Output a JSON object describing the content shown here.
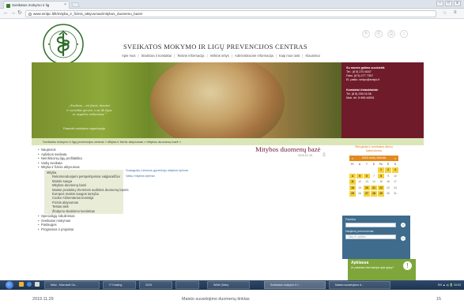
{
  "browser": {
    "tab_title": "Sveikatos mokymo ir lig",
    "url": "www.smlpc.lt/lt/mityba_ir_fizinis_aktyvumas/mitybos_duomenu_baze/",
    "win_min": "–",
    "win_max": "□",
    "win_close": "x"
  },
  "header": {
    "site_title": "SVEIKATOS MOKYMO IR LIGŲ PREVENCIJOS CENTRAS",
    "top_nav": [
      "Apie mus",
      "Struktūra ir kontaktai",
      "Teisinė informacija",
      "Veiklos sritys",
      "Administracinė informacija",
      "Kaip mus rasti",
      "Klausimai"
    ],
    "top_icons": [
      "Ⓐ",
      "⎘",
      "⎙",
      "⌂"
    ]
  },
  "banner": {
    "quote_lines": [
      "„Sveikata – tai fizinė, dvasinė",
      "ir socialinė gerovė, o ne tik ligos",
      "ar negalios nebuvimas.\""
    ],
    "quote_author": "Pasaulio sveikatos organizacija"
  },
  "contact": {
    "heading": "Su mumis galima susisiekti:",
    "lines": [
      "Tel.: (8 5) 270 8167",
      "Faks. (8 5) 277 7307",
      "El. paštu: smlpc@smlpc.lt"
    ],
    "heading2": "Kontaktai žiniasklaidai:",
    "lines2": [
      "Tel. (8 5) 236 04 56",
      "Mob. tel. 8 698 46591"
    ]
  },
  "breadcrumb": [
    "Sveikatos mokymo ir ligų prevencijos centras",
    "Mityba ir fizinis aktyvumas",
    "Mitybos duomenų bazė"
  ],
  "sidebar": {
    "items_top": [
      "Naujienos",
      "Aplinkos sveikata",
      "Neinfekcinių ligų profilaktika",
      "Vaikų sveikata",
      "Mityba ir fizinis aktyvumas"
    ],
    "sub_items": [
      "Mityba",
      "Rekomenduojami perspektyviniai valgiaraščiai",
      "Maisto sauga",
      "Mitybos duomenų bazė",
      "Maisto produktų cheminės sudėties duomenų bazės",
      "Europos maisto saugos tarnyba",
      "Codex Alimentarius komisija",
      "Fizinis aktyvumas",
      "Testas akis",
      "Žindymo skatinimo komitetas"
    ],
    "items_bottom": [
      "Specialiųjų tobulinimas",
      "Sveikatos mokymas",
      "Paslaugos",
      "Programos ir projektai"
    ]
  },
  "main": {
    "title": "Mitybos duomenų bazė",
    "date": "2015.01.15",
    "links": [
      "Suaugusių Lietuvos gyventojų mitybos tyrimai",
      "Vaikų mitybos tyrimai"
    ]
  },
  "calendar": {
    "title": "Renginiai ir sveikatos dienų kalendorius",
    "month": "2015 metų birželis",
    "weekdays": [
      "Pr",
      "A",
      "T",
      "K",
      "Pn",
      "Š",
      "S"
    ],
    "days": [
      "",
      "",
      "",
      "",
      "1",
      "2",
      "3",
      "4",
      "5",
      "6",
      "7",
      "8",
      "9",
      "10",
      "11",
      "12",
      "13",
      "14",
      "15",
      "16",
      "17",
      "18",
      "19",
      "20",
      "21",
      "22",
      "23",
      "24",
      "25",
      "26",
      "27",
      "28",
      "29",
      "30",
      "31"
    ],
    "event_days": [
      "1",
      "2",
      "3",
      "4",
      "5",
      "6",
      "8",
      "11",
      "18",
      "20",
      "21",
      "22",
      "25",
      "27",
      "28",
      "29"
    ],
    "prev": "«",
    "next": "»"
  },
  "search": {
    "label": "Paieška",
    "go": "»",
    "subscribe_label": "Naujienų prenumerata",
    "subscribe_placeholder": "Jūsų el. paštas"
  },
  "poll": {
    "title": "Apklausa",
    "question": "Ar pakanka informacijos apie gripą?",
    "icon": "!"
  },
  "taskbar": {
    "buttons": [
      "Mitai - Microsoft Go...",
      "IT Hosting",
      "2015",
      "",
      "WAW (Wav)",
      "Sveikatos mokymo ir l...",
      "Maisto suvartojimo d..."
    ],
    "tray": "EN  ▲  ◂)  🔋  10:03"
  },
  "footer": {
    "date": "2019.11.29",
    "title": "Maisto suvartojimo duomenų tinklas",
    "page": "15"
  },
  "colors": {
    "maroon": "#6f1b2a",
    "green_light": "#dbe6b8",
    "orange": "#e28a1e",
    "blue_panel": "#3f6b8d",
    "poll_green": "#7ea63a"
  }
}
